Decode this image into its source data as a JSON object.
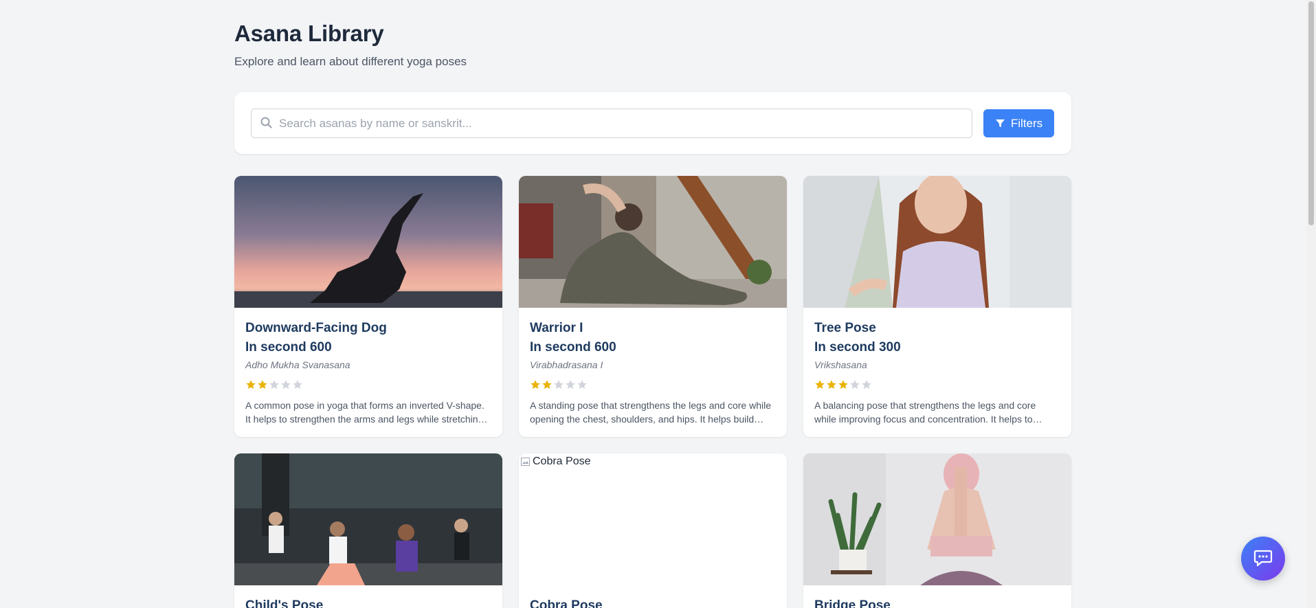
{
  "header": {
    "title": "Asana Library",
    "subtitle": "Explore and learn about different yoga poses"
  },
  "search": {
    "placeholder": "Search asanas by name or sanskrit...",
    "value": "",
    "filters_label": "Filters"
  },
  "colors": {
    "accent": "#3b82f6",
    "star_filled": "#eab308",
    "star_empty": "#d1d5db",
    "title_text": "#1e3a5f"
  },
  "cards": [
    {
      "title": "Downward-Facing Dog",
      "duration": "In second 600",
      "sanskrit": "Adho Mukha Svanasana",
      "rating": 2,
      "description": "A common pose in yoga that forms an inverted V-shape. It helps to strengthen the arms and legs while stretching the back.",
      "image": "sunset-silhouette-pose"
    },
    {
      "title": "Warrior I",
      "duration": "In second 600",
      "sanskrit": "Virabhadrasana I",
      "rating": 2,
      "description": "A standing pose that strengthens the legs and core while opening the chest, shoulders, and hips. It helps build stamina.",
      "image": "indoor-backbend-pose"
    },
    {
      "title": "Tree Pose",
      "duration": "In second 300",
      "sanskrit": "Vrikshasana",
      "rating": 3,
      "description": "A balancing pose that strengthens the legs and core while improving focus and concentration. It helps to improve posture.",
      "image": "seated-meditation"
    },
    {
      "title": "Child's Pose",
      "image": "group-class-warrior"
    },
    {
      "title": "Cobra Pose",
      "image_alt": "Cobra Pose",
      "image": "broken-image"
    },
    {
      "title": "Bridge Pose",
      "image": "eagle-arms-pose"
    }
  ],
  "chat": {
    "icon": "chat-icon"
  }
}
